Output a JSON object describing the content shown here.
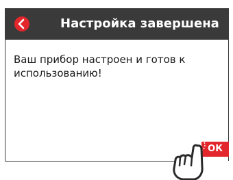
{
  "header": {
    "title": "Настройка завершена",
    "back_icon": "chevron-left-icon"
  },
  "message": {
    "text": "Ваш прибор настроен и готов к использованию!"
  },
  "ok_button": {
    "label": "ОК"
  },
  "pointer": {
    "icon": "hand-pointer-icon"
  },
  "colors": {
    "header_bg": "#3a3a3a",
    "accent_red": "#e3262b",
    "text": "#1a1a1a"
  }
}
